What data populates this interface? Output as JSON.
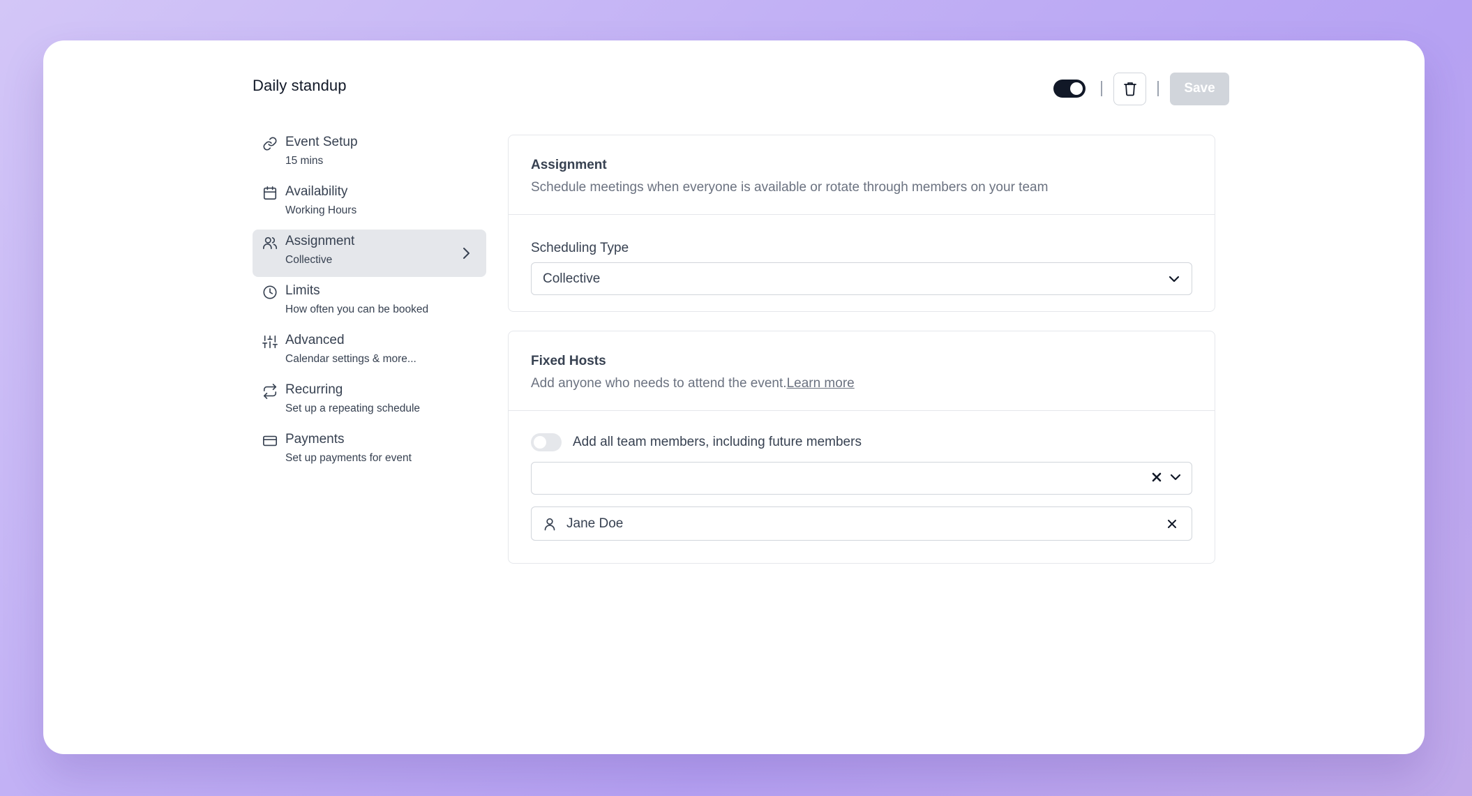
{
  "page": {
    "title": "Daily standup"
  },
  "toolbar": {
    "enabled": true,
    "save_label": "Save"
  },
  "sidebar": {
    "items": [
      {
        "label": "Event Setup",
        "sub": "15 mins",
        "icon": "link-icon"
      },
      {
        "label": "Availability",
        "sub": "Working Hours",
        "icon": "calendar-icon"
      },
      {
        "label": "Assignment",
        "sub": "Collective",
        "icon": "users-icon",
        "active": true
      },
      {
        "label": "Limits",
        "sub": "How often you can be booked",
        "icon": "clock-icon"
      },
      {
        "label": "Advanced",
        "sub": "Calendar settings & more...",
        "icon": "sliders-icon"
      },
      {
        "label": "Recurring",
        "sub": "Set up a repeating schedule",
        "icon": "repeat-icon"
      },
      {
        "label": "Payments",
        "sub": "Set up payments for event",
        "icon": "credit-card-icon"
      }
    ]
  },
  "assignment": {
    "title": "Assignment",
    "description": "Schedule meetings when everyone is available or rotate through members on your team",
    "scheduling_label": "Scheduling Type",
    "scheduling_value": "Collective"
  },
  "fixed_hosts": {
    "title": "Fixed Hosts",
    "description": "Add anyone who needs to attend the event.",
    "learn_more": "Learn more",
    "toggle_label": "Add all team members, including future members",
    "toggle_on": false,
    "hosts": [
      {
        "name": "Jane Doe"
      }
    ]
  },
  "colors": {
    "primary": "#111827",
    "muted_text": "#6b7280",
    "border": "#e5e7eb",
    "active_bg": "#e5e7eb",
    "disabled_button": "#d1d5db"
  }
}
